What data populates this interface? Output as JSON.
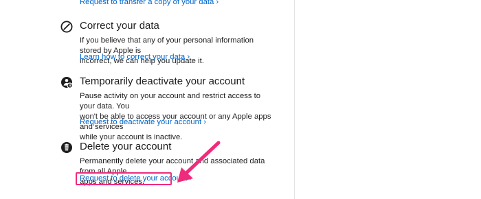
{
  "top_link": "Request to transfer a copy of your data ›",
  "sections": [
    {
      "icon": "pencil-slash-icon",
      "title": "Correct your data",
      "desc_lines": [
        "If you believe that any of your personal information stored by Apple is",
        "incorrect, we can help you update it."
      ],
      "link": "Learn how to correct your data ›"
    },
    {
      "icon": "deactivate-account-icon",
      "title": "Temporarily deactivate your account",
      "desc_lines": [
        "Pause activity on your account and restrict access to your data. You",
        "won't be able to access your account or any Apple apps and services",
        "while your account is inactive."
      ],
      "link": "Request to deactivate your account ›"
    },
    {
      "icon": "trash-icon",
      "title": "Delete your account",
      "desc_lines": [
        "Permanently delete your account and associated data from all Apple",
        "apps and services."
      ],
      "link": "Request to delete your account ›"
    }
  ],
  "colors": {
    "link": "#0066cc",
    "text": "#1d1d1f",
    "annotation": "#ef2b7c",
    "divider": "#e2e2e5"
  }
}
